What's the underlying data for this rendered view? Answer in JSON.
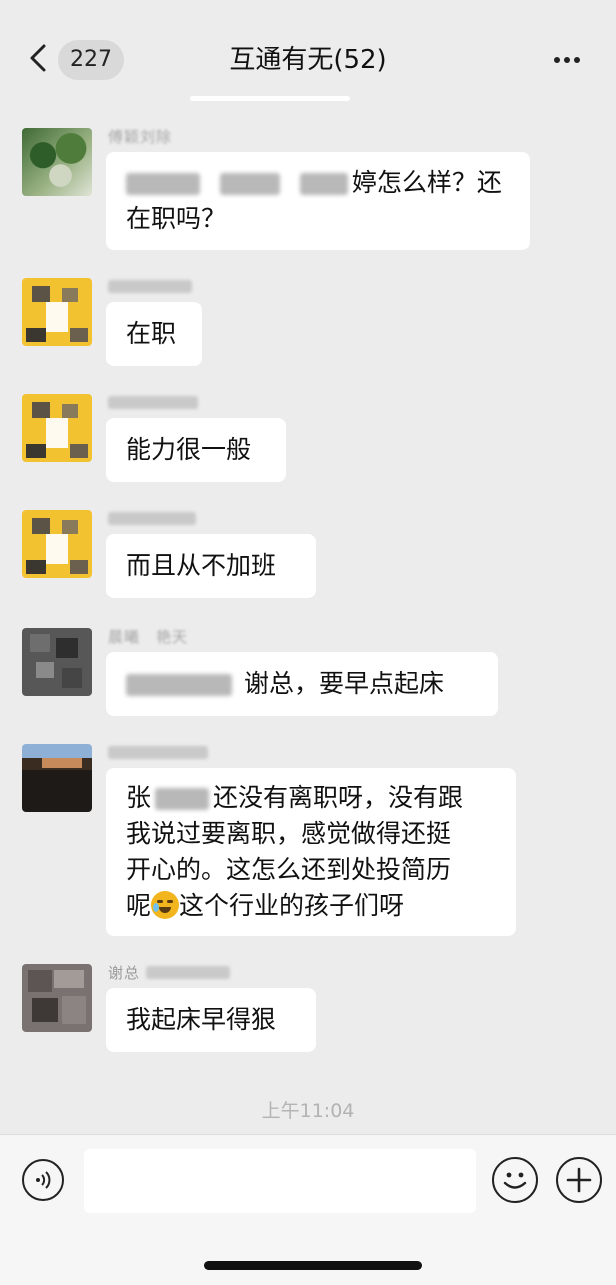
{
  "header": {
    "back_icon": "chevron-left-icon",
    "unread_count": "227",
    "title": "互通有无(52)",
    "more_icon": "ellipsis-icon"
  },
  "messages": [
    {
      "avatar": "nature-photo",
      "sender": "傅颖刘除",
      "segments": [
        "婷怎么样？还",
        "在职吗？"
      ]
    },
    {
      "avatar": "yellow-mosaic",
      "sender": "",
      "text": "在职"
    },
    {
      "avatar": "yellow-mosaic",
      "sender": "",
      "text": "能力很一般"
    },
    {
      "avatar": "yellow-mosaic",
      "sender": "",
      "text": "而且从不加班"
    },
    {
      "avatar": "dark-mosaic",
      "sender": "晨曦　艳天",
      "text": "谢总，要早点起床"
    },
    {
      "avatar": "brown-photo",
      "sender": "",
      "segments": [
        "张",
        "还没有离职呀，没有跟",
        "我说过要离职，感觉做得还挺",
        "开心的。这怎么还到处投简历",
        "呢",
        "这个行业的孩子们呀"
      ]
    },
    {
      "avatar": "gray-mosaic",
      "sender": "谢总",
      "text": "我起床早得狠"
    }
  ],
  "timestamp": "上午11:04",
  "input_bar": {
    "voice_icon": "voice-icon",
    "input_value": "",
    "emoji_icon": "smiley-icon",
    "add_icon": "plus-icon"
  }
}
